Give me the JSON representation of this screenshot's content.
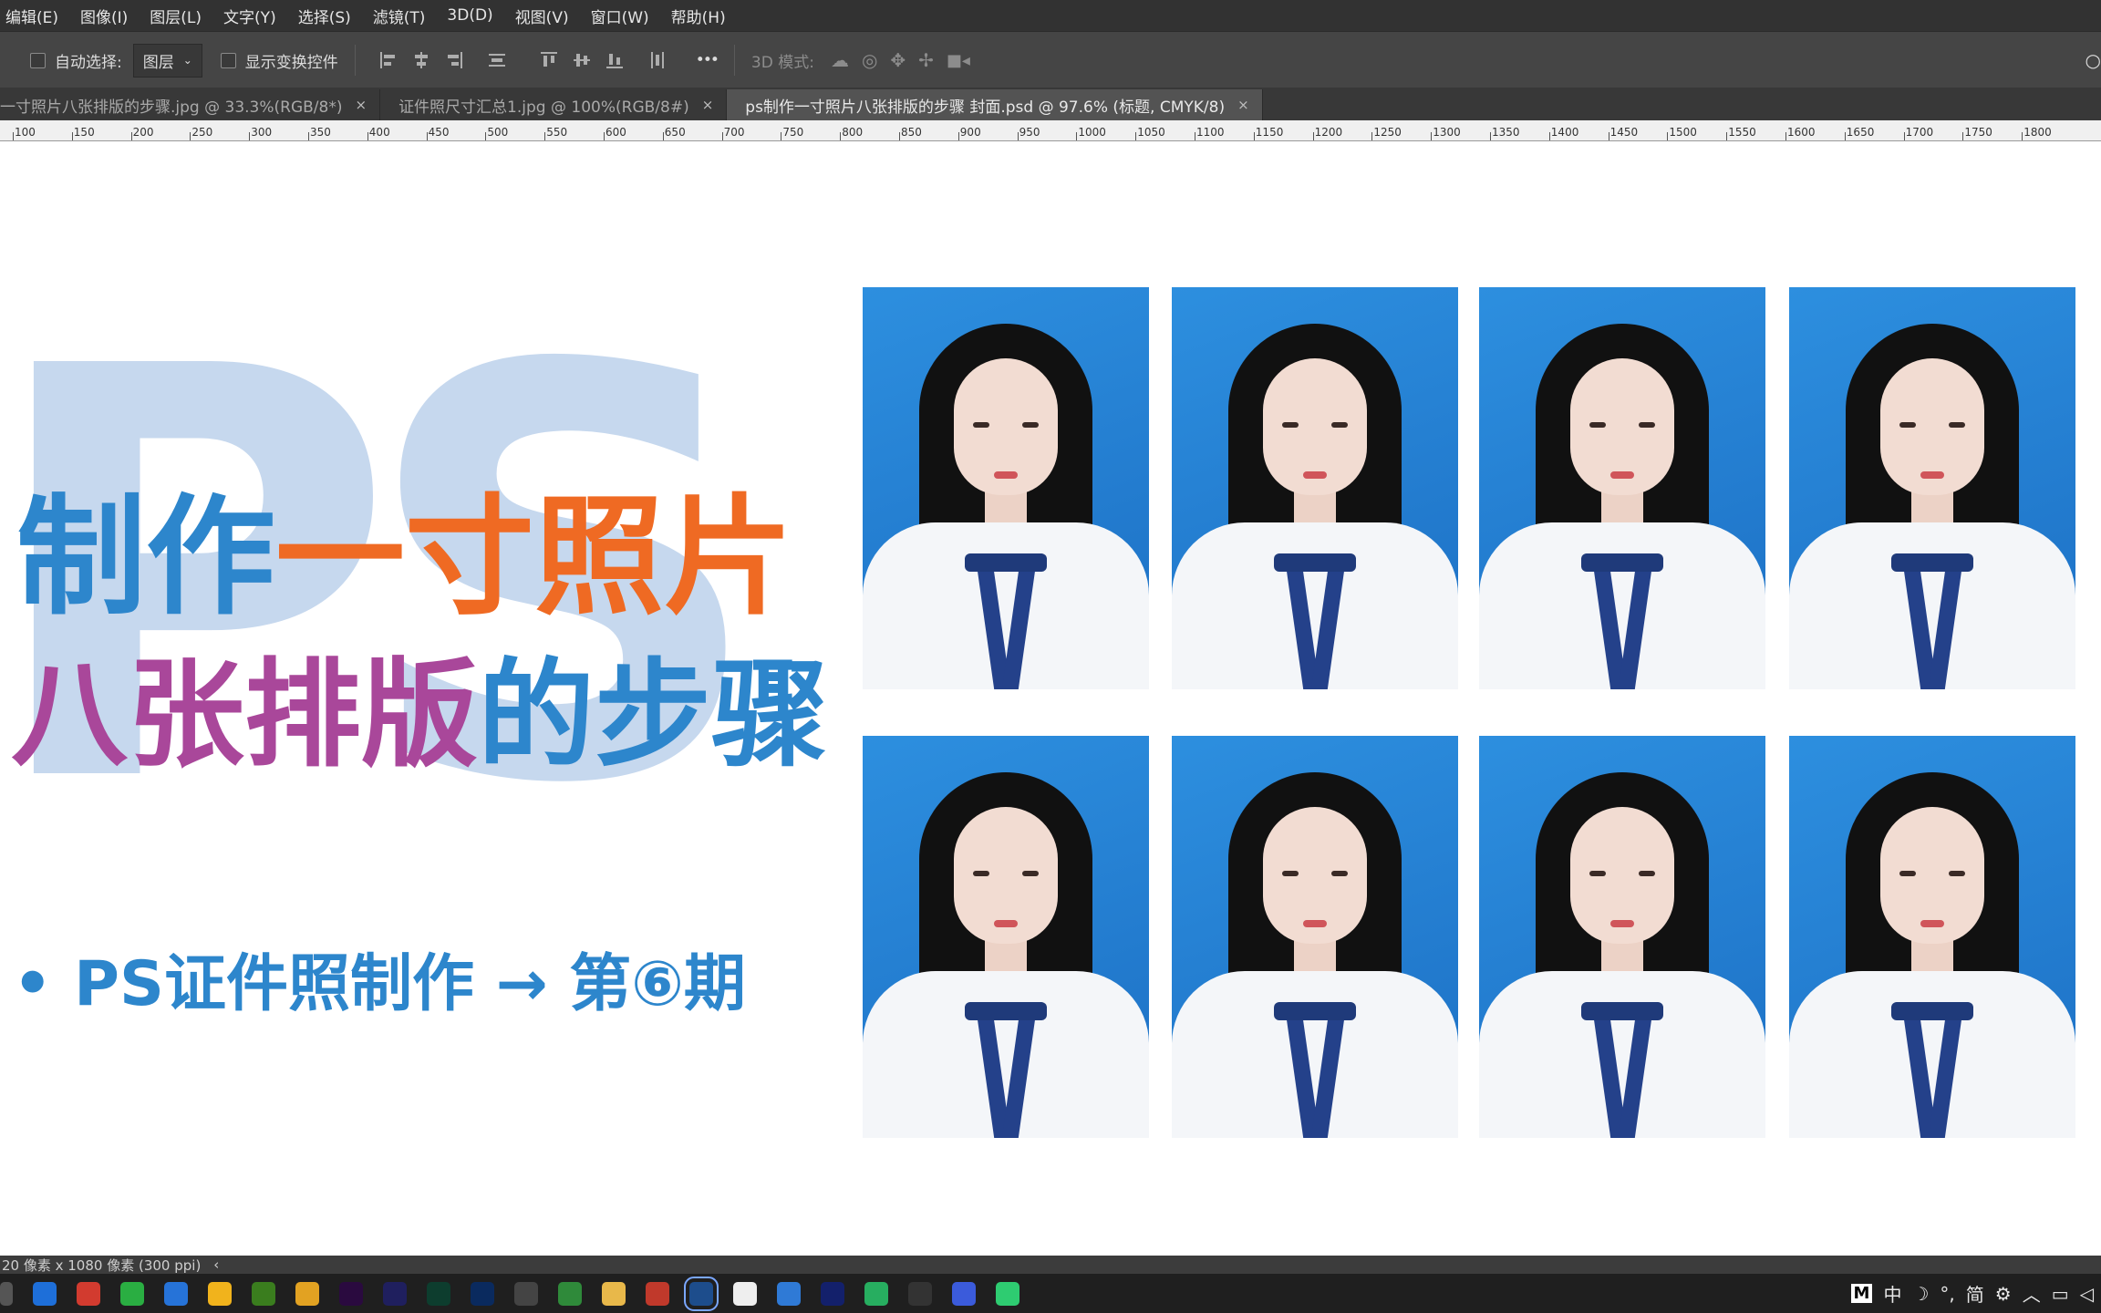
{
  "menu": [
    "编辑(E)",
    "图像(I)",
    "图层(L)",
    "文字(Y)",
    "选择(S)",
    "滤镜(T)",
    "3D(D)",
    "视图(V)",
    "窗口(W)",
    "帮助(H)"
  ],
  "options": {
    "auto_select_label": "自动选择:",
    "auto_select_value": "图层",
    "show_transform_label": "显示变换控件",
    "more": "•••",
    "mode_3d_label": "3D 模式:"
  },
  "tabs": [
    {
      "label": "一寸照片八张排版的步骤.jpg @ 33.3%(RGB/8*)",
      "close": "×"
    },
    {
      "label": "证件照尺寸汇总1.jpg @ 100%(RGB/8#)",
      "close": "×"
    },
    {
      "label": "ps制作一寸照片八张排版的步骤 封面.psd @ 97.6% (标题, CMYK/8)",
      "close": "×"
    }
  ],
  "ruler_ticks": [
    "100",
    "150",
    "200",
    "250",
    "300",
    "350",
    "400",
    "450",
    "500",
    "550",
    "600",
    "650",
    "700",
    "750",
    "800",
    "850",
    "900",
    "950",
    "1000",
    "1050",
    "1100",
    "1150",
    "1200",
    "1250",
    "1300",
    "1350",
    "1400",
    "1450",
    "1500",
    "1550",
    "1600",
    "1650",
    "1700",
    "1750",
    "1800"
  ],
  "canvas": {
    "bg_text": "PS",
    "title_line1_part1": "制作",
    "title_line1_part2": "一寸照片",
    "title_line2_part1": "八张排版",
    "title_line2_part2": "的步骤",
    "subtitle": "• PS证件照制作 → 第⑥期",
    "colors": {
      "blue": "#2d86cc",
      "orange": "#ef6a23",
      "purple": "#a9479a",
      "bg_text": "#c6d8ee",
      "photo_bg": "#1f78d1"
    }
  },
  "status": {
    "doc_size": "20 像素 x 1080 像素 (300 ppi)",
    "arrow": "‹"
  },
  "taskbar_icons": [
    "start",
    "browser-ie",
    "news",
    "wechat",
    "bluebox",
    "folder-app",
    "dreamweaver",
    "chrome",
    "premiere",
    "after-effects",
    "audition",
    "photoshop",
    "obs",
    "camtasia",
    "file-explorer",
    "paint",
    "photoshop-active",
    "notes",
    "bilibili",
    "photoshop-2",
    "chat-green",
    "capcut",
    "media",
    "player"
  ],
  "tray": {
    "ime": "M",
    "lang": "中",
    "punct": "°,",
    "simp": "简"
  }
}
